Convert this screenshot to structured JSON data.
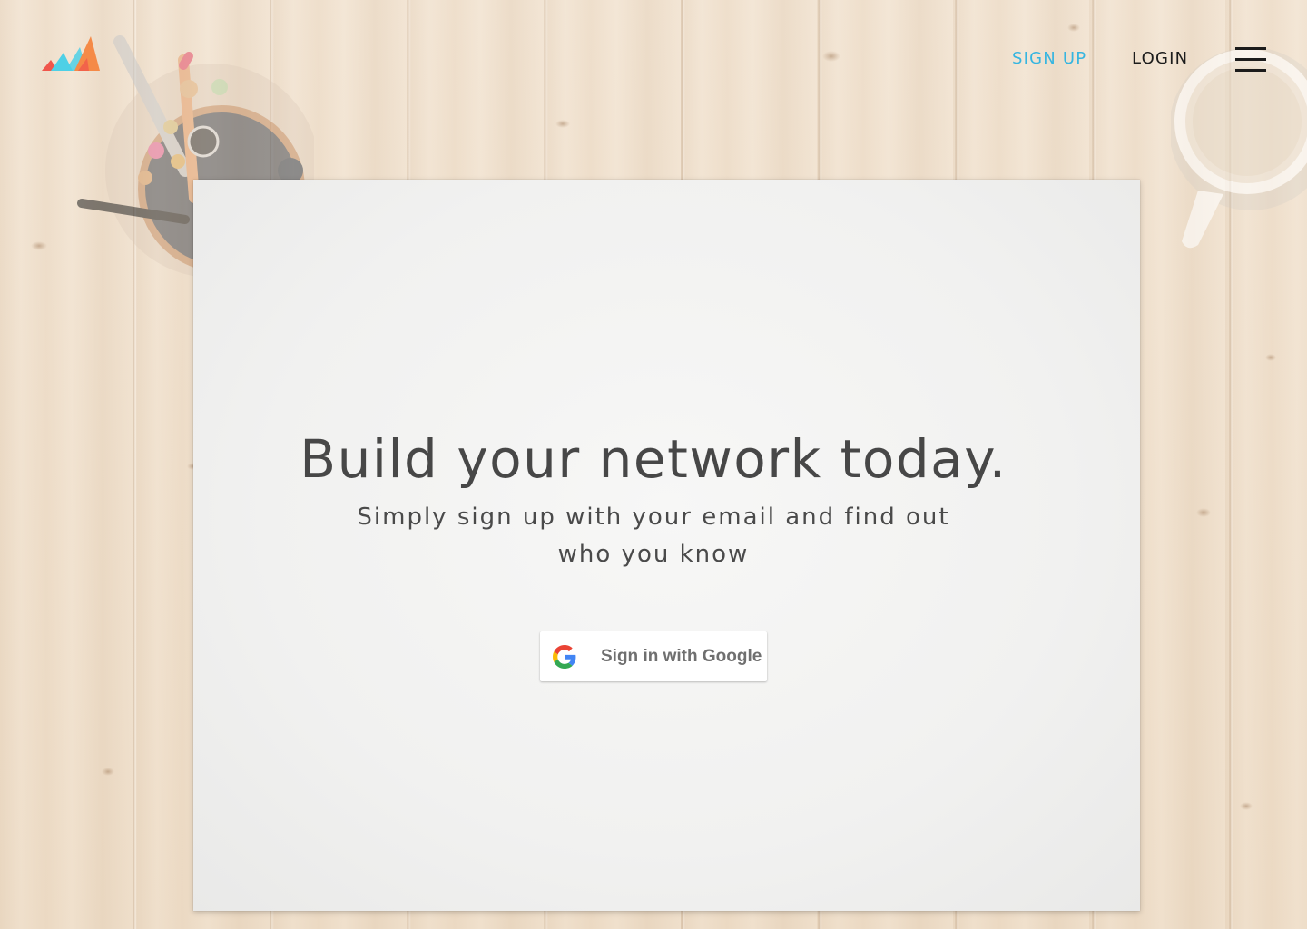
{
  "header": {
    "logo_icon": "mountain-peaks-logo-icon",
    "signup_label": "SIGN UP",
    "login_label": "LOGIN",
    "menu_icon": "hamburger-menu-icon"
  },
  "hero": {
    "headline": "Build your network today.",
    "subline_1": "Simply sign up with your email and find out",
    "subline_2": "who you know",
    "google_button_label": "Sign in with Google",
    "google_icon": "google-g-icon"
  },
  "colors": {
    "accent": "#36b5e0",
    "nav_text": "#1c1c1c",
    "headline_text": "#474747",
    "logo_red": "#f0564b",
    "logo_cyan": "#4ed0e6",
    "logo_orange": "#f58a47"
  }
}
